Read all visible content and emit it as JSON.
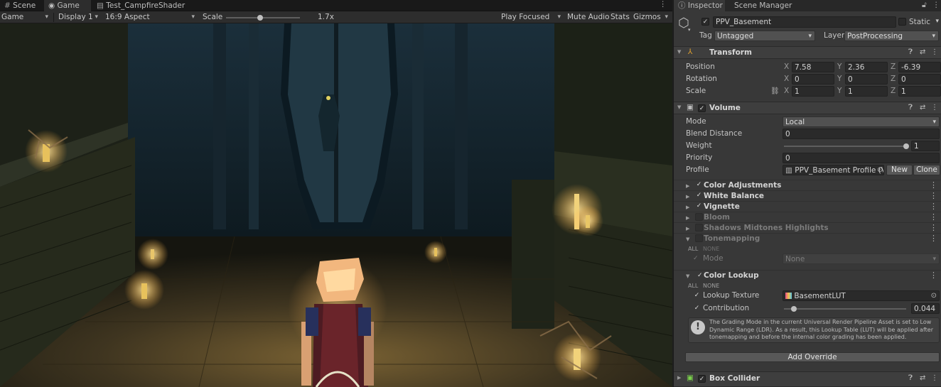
{
  "left_tabs": {
    "scene": "Scene",
    "game": "Game",
    "shader": "Test_CampfireShader"
  },
  "game_toolbar": {
    "mode": "Game",
    "display": "Display 1",
    "aspect": "16:9 Aspect",
    "scale_label": "Scale",
    "scale_value": "1.7x",
    "scale_fraction": 0.46,
    "play_focused": "Play Focused",
    "mute_audio": "Mute Audio",
    "stats": "Stats",
    "gizmos": "Gizmos"
  },
  "right_tabs": {
    "inspector": "Inspector",
    "scene_manager": "Scene Manager"
  },
  "object": {
    "name": "PPV_Basement",
    "static_label": "Static",
    "tag_label": "Tag",
    "tag_value": "Untagged",
    "layer_label": "Layer",
    "layer_value": "PostProcessing"
  },
  "transform": {
    "title": "Transform",
    "position_label": "Position",
    "rotation_label": "Rotation",
    "scale_label": "Scale",
    "x": "X",
    "y": "Y",
    "z": "Z",
    "position": [
      "7.58",
      "2.36",
      "-6.39"
    ],
    "rotation": [
      "0",
      "0",
      "0"
    ],
    "scale": [
      "1",
      "1",
      "1"
    ]
  },
  "volume": {
    "title": "Volume",
    "mode_label": "Mode",
    "mode_value": "Local",
    "blend_label": "Blend Distance",
    "blend_value": "0",
    "weight_label": "Weight",
    "weight_value": "1",
    "weight_fraction": 1.0,
    "priority_label": "Priority",
    "priority_value": "0",
    "profile_label": "Profile",
    "profile_value": "PPV_Basement Profile (V",
    "new_button": "New",
    "clone_button": "Clone"
  },
  "overrides": [
    {
      "name": "Color Adjustments",
      "enabled": true
    },
    {
      "name": "White Balance",
      "enabled": true
    },
    {
      "name": "Vignette",
      "enabled": true
    },
    {
      "name": "Bloom",
      "enabled": false
    },
    {
      "name": "Shadows Midtones Highlights",
      "enabled": false
    },
    {
      "name": "Tonemapping",
      "enabled": false
    }
  ],
  "tonemapping": {
    "all": "ALL",
    "none": "NONE",
    "mode_label": "Mode",
    "mode_value": "None"
  },
  "color_lookup": {
    "title": "Color Lookup",
    "all": "ALL",
    "none": "NONE",
    "texture_label": "Lookup Texture",
    "texture_value": "BasementLUT",
    "contribution_label": "Contribution",
    "contribution_value": "0.044",
    "contribution_fraction": 0.044,
    "info": "The Grading Mode in the current Universal Render Pipeline Asset is set to Low Dynamic Range (LDR). As a result, this Lookup Table (LUT) will be applied after tonemapping and before the internal color grading has been applied."
  },
  "add_override": "Add Override",
  "box_collider": "Box Collider",
  "colors": {
    "panel": "#383838",
    "header": "#3e3e3e",
    "field": "#2a2a2a",
    "accent_green": "#7bd14b"
  }
}
